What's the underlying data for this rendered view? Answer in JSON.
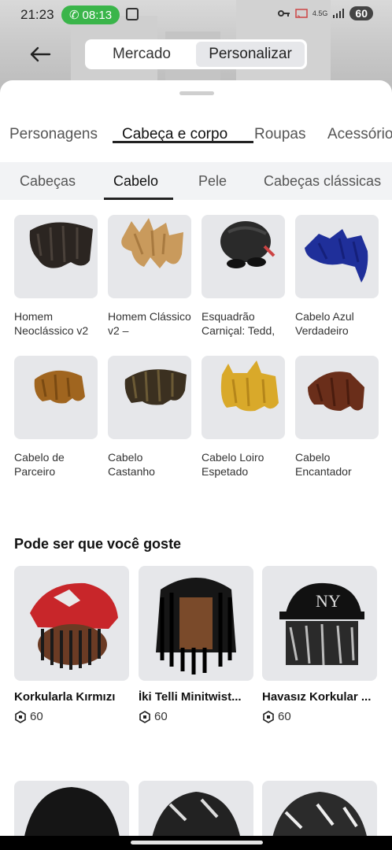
{
  "status_bar": {
    "time": "21:23",
    "call_timer": "08:13",
    "network": "4.5G",
    "battery": "60"
  },
  "header": {
    "segments": [
      {
        "label": "Mercado",
        "active": false
      },
      {
        "label": "Personalizar",
        "active": true
      }
    ]
  },
  "category_tabs": [
    {
      "label": "Personagens",
      "active": false
    },
    {
      "label": "Cabeça e corpo",
      "active": true
    },
    {
      "label": "Roupas",
      "active": false
    },
    {
      "label": "Acessório",
      "active": false
    }
  ],
  "sub_tabs": [
    {
      "label": "Cabeças",
      "active": false
    },
    {
      "label": "Cabelo",
      "active": true
    },
    {
      "label": "Pele",
      "active": false
    },
    {
      "label": "Cabeças clássicas",
      "active": false
    }
  ],
  "items": [
    {
      "name": "Homem Neoclássico v2",
      "hair_color": "#2b2521"
    },
    {
      "name": "Homem Clássico v2 –",
      "hair_color": "#c99a5c"
    },
    {
      "name": "Esquadrão Carniçal: Tedd,",
      "hair_color": "#2a2a2a"
    },
    {
      "name": "Cabelo Azul Verdadeiro",
      "hair_color": "#1f2f9a"
    },
    {
      "name": "Cabelo de Parceiro",
      "hair_color": "#a0651f"
    },
    {
      "name": "Cabelo Castanho",
      "hair_color": "#3b3020"
    },
    {
      "name": "Cabelo Loiro Espetado",
      "hair_color": "#d9a92a"
    },
    {
      "name": "Cabelo Encantador",
      "hair_color": "#6a2e1a"
    }
  ],
  "recommendations": {
    "title": "Pode ser que você goste",
    "items": [
      {
        "name": "Korkularla Kırmızı",
        "price": "60"
      },
      {
        "name": "İki Telli Minitwist...",
        "price": "60"
      },
      {
        "name": "Havasız Korkular ...",
        "price": "60"
      }
    ]
  }
}
